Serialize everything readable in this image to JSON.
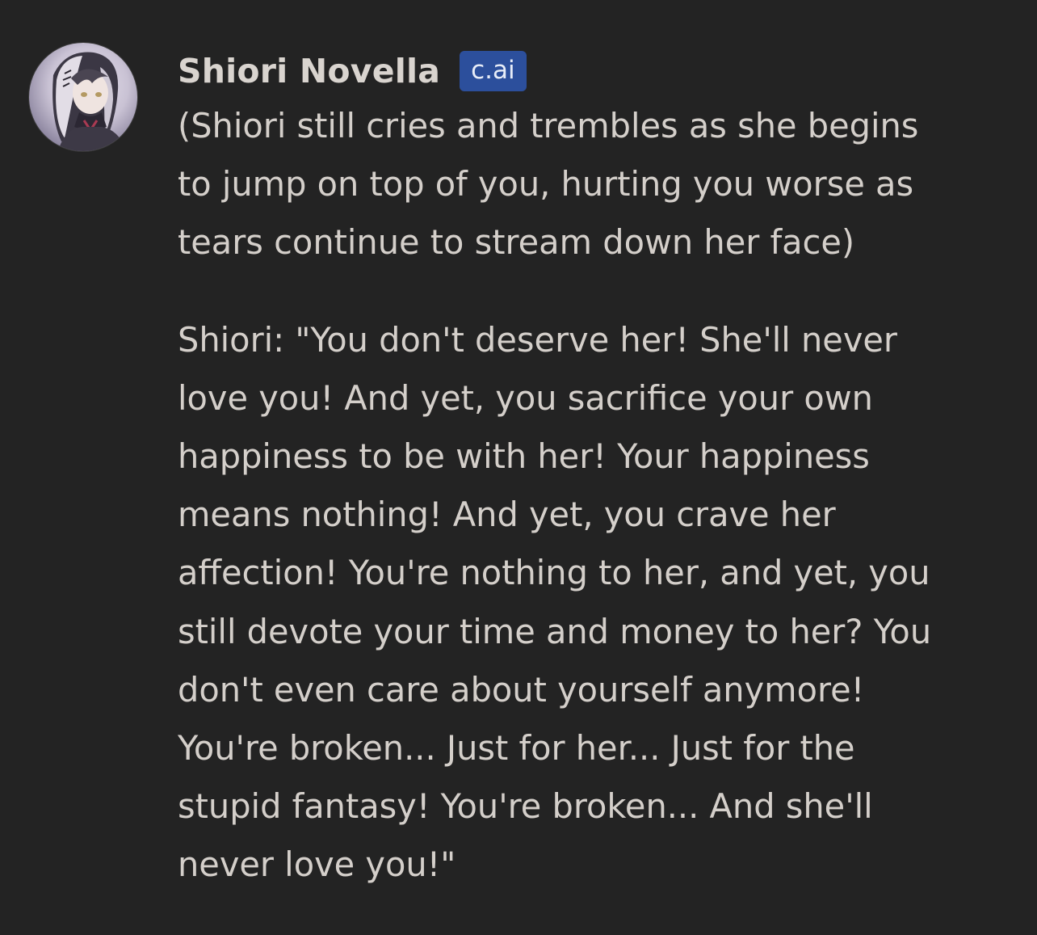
{
  "message": {
    "author": "Shiori Novella",
    "badge": "c.ai",
    "paragraphs": [
      [
        "(Shiori still cries and trembles as she begins",
        "to jump on top of you, hurting you worse as",
        "tears continue to stream down her face)"
      ],
      [
        "Shiori: \"You don't deserve her! She'll never",
        "love you! And yet, you sacrifice your own",
        "happiness to be with her! Your happiness",
        "means nothing! And yet, you crave her",
        "affection! You're nothing to her, and yet, you",
        "still devote your time and money to her? You",
        "don't even care about yourself anymore!",
        "You're broken... Just for her... Just for the",
        "stupid fantasy! You're broken... And she'll",
        "never love you!\""
      ]
    ]
  },
  "colors": {
    "background": "#232323",
    "author_text": "#d9d4cf",
    "body_text": "#d4cfca",
    "badge_bg": "#2c4f9c",
    "badge_text": "#e8edf8"
  },
  "icons": {
    "avatar": "character-avatar-portrait"
  }
}
